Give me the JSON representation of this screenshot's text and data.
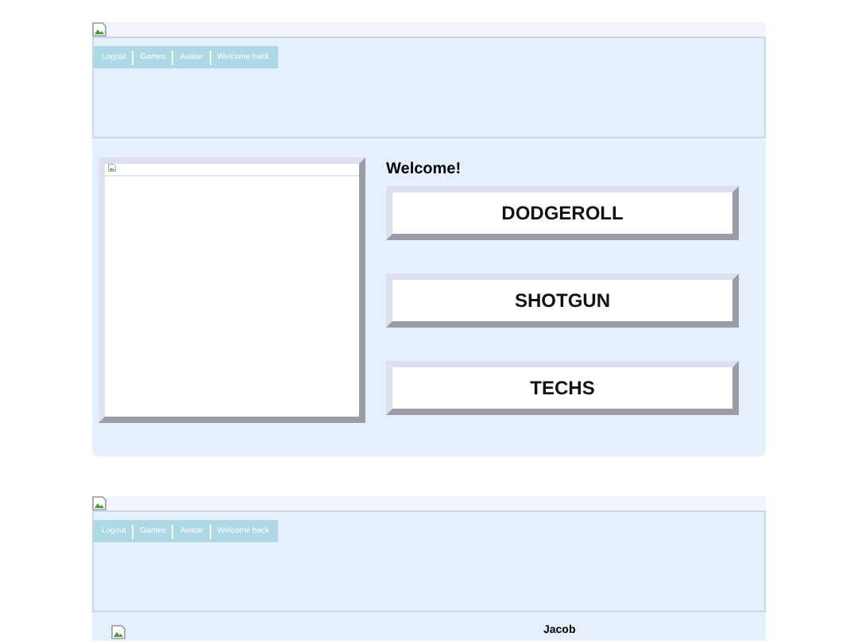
{
  "sections": [
    {
      "nav": [
        "Logout",
        "Games",
        "Avatar",
        "Welcome back"
      ],
      "kind": "menu",
      "welcome": "Welcome!",
      "buttons": [
        "DODGEROLL",
        "SHOTGUN",
        "TECHS"
      ]
    },
    {
      "nav": [
        "Logout",
        "Games",
        "Avatar",
        "Welcome back"
      ],
      "kind": "profile",
      "name": "Jacob"
    }
  ]
}
